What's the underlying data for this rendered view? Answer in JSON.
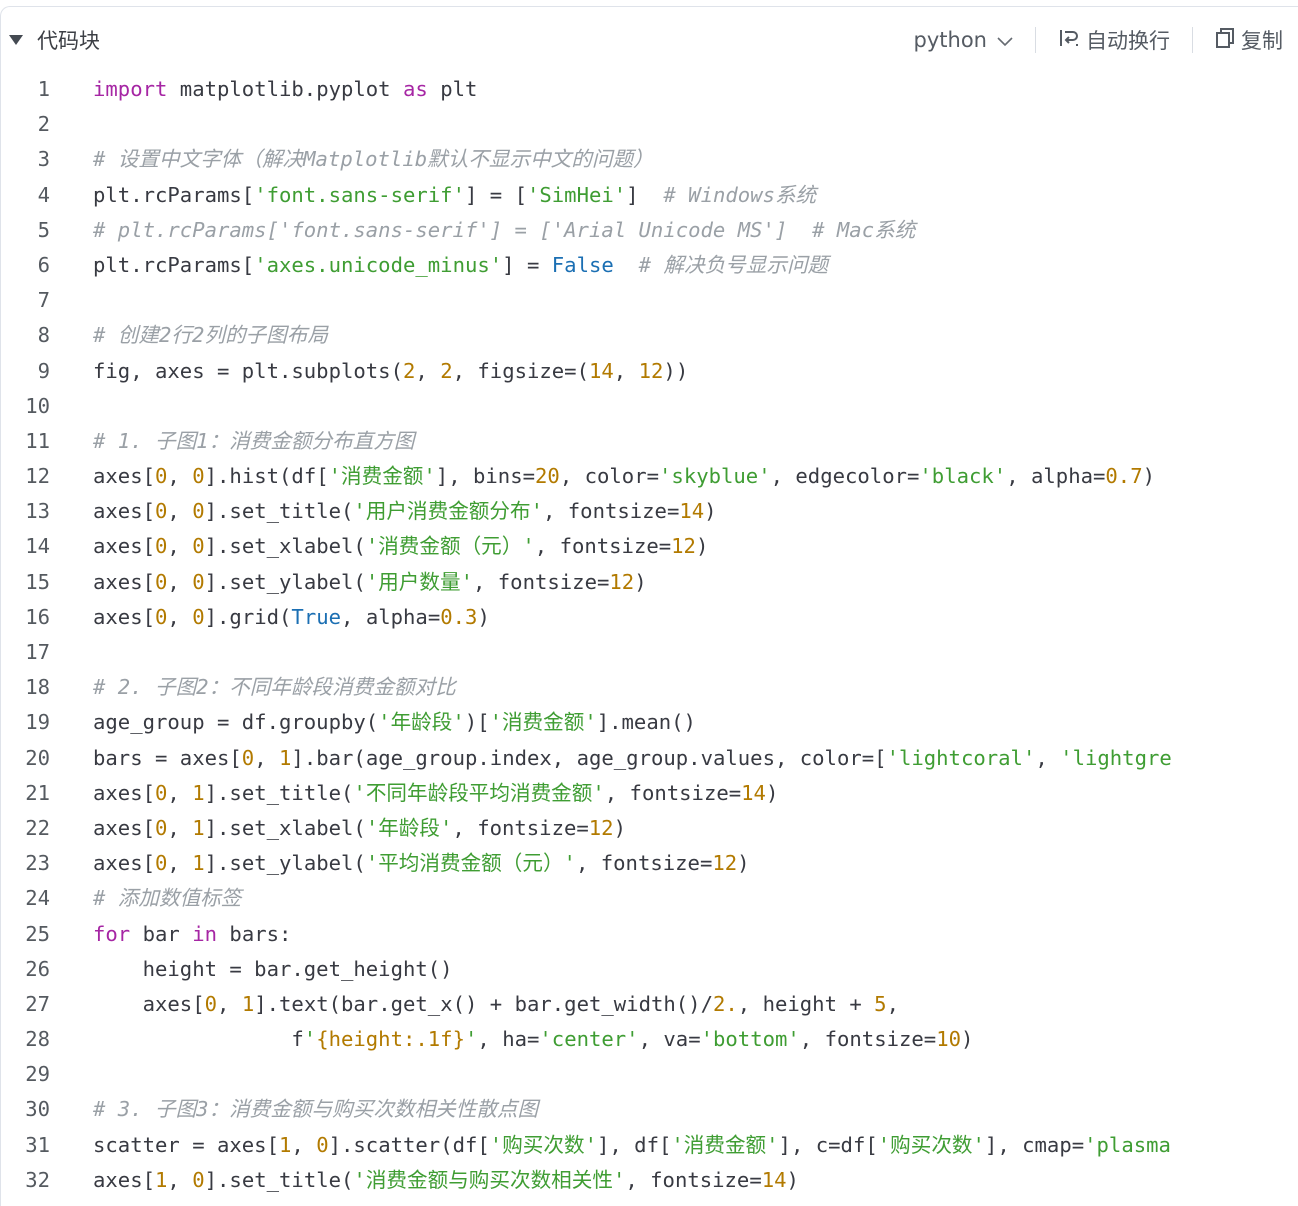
{
  "header": {
    "block_label": "代码块",
    "language": "python",
    "wrap_label": "自动换行",
    "copy_label": "复制"
  },
  "lines": [
    {
      "no": "1",
      "tokens": [
        [
          "k",
          "import"
        ],
        [
          "p",
          " matplotlib.pyplot "
        ],
        [
          "k",
          "as"
        ],
        [
          "p",
          " plt"
        ]
      ]
    },
    {
      "no": "2",
      "tokens": []
    },
    {
      "no": "3",
      "tokens": [
        [
          "c",
          "# 设置中文字体（解决Matplotlib默认不显示中文的问题）"
        ]
      ]
    },
    {
      "no": "4",
      "tokens": [
        [
          "p",
          "plt.rcParams["
        ],
        [
          "s",
          "'font.sans-serif'"
        ],
        [
          "p",
          "] = ["
        ],
        [
          "s",
          "'SimHei'"
        ],
        [
          "p",
          "]  "
        ],
        [
          "c",
          "# Windows系统"
        ]
      ]
    },
    {
      "no": "5",
      "tokens": [
        [
          "c",
          "# plt.rcParams['font.sans-serif'] = ['Arial Unicode MS']  # Mac系统"
        ]
      ]
    },
    {
      "no": "6",
      "tokens": [
        [
          "p",
          "plt.rcParams["
        ],
        [
          "s",
          "'axes.unicode_minus'"
        ],
        [
          "p",
          "] = "
        ],
        [
          "b",
          "False"
        ],
        [
          "p",
          "  "
        ],
        [
          "c",
          "# 解决负号显示问题"
        ]
      ]
    },
    {
      "no": "7",
      "tokens": []
    },
    {
      "no": "8",
      "tokens": [
        [
          "c",
          "# 创建2行2列的子图布局"
        ]
      ]
    },
    {
      "no": "9",
      "tokens": [
        [
          "p",
          "fig, axes = plt.subplots("
        ],
        [
          "n",
          "2"
        ],
        [
          "p",
          ", "
        ],
        [
          "n",
          "2"
        ],
        [
          "p",
          ", figsize=("
        ],
        [
          "n",
          "14"
        ],
        [
          "p",
          ", "
        ],
        [
          "n",
          "12"
        ],
        [
          "p",
          "))"
        ]
      ]
    },
    {
      "no": "10",
      "tokens": []
    },
    {
      "no": "11",
      "tokens": [
        [
          "c",
          "# 1. 子图1：消费金额分布直方图"
        ]
      ]
    },
    {
      "no": "12",
      "tokens": [
        [
          "p",
          "axes["
        ],
        [
          "n",
          "0"
        ],
        [
          "p",
          ", "
        ],
        [
          "n",
          "0"
        ],
        [
          "p",
          "].hist(df["
        ],
        [
          "s",
          "'消费金额'"
        ],
        [
          "p",
          "], bins="
        ],
        [
          "n",
          "20"
        ],
        [
          "p",
          ", color="
        ],
        [
          "s",
          "'skyblue'"
        ],
        [
          "p",
          ", edgecolor="
        ],
        [
          "s",
          "'black'"
        ],
        [
          "p",
          ", alpha="
        ],
        [
          "n",
          "0.7"
        ],
        [
          "p",
          ")"
        ]
      ]
    },
    {
      "no": "13",
      "tokens": [
        [
          "p",
          "axes["
        ],
        [
          "n",
          "0"
        ],
        [
          "p",
          ", "
        ],
        [
          "n",
          "0"
        ],
        [
          "p",
          "].set_title("
        ],
        [
          "s",
          "'用户消费金额分布'"
        ],
        [
          "p",
          ", fontsize="
        ],
        [
          "n",
          "14"
        ],
        [
          "p",
          ")"
        ]
      ]
    },
    {
      "no": "14",
      "tokens": [
        [
          "p",
          "axes["
        ],
        [
          "n",
          "0"
        ],
        [
          "p",
          ", "
        ],
        [
          "n",
          "0"
        ],
        [
          "p",
          "].set_xlabel("
        ],
        [
          "s",
          "'消费金额（元）'"
        ],
        [
          "p",
          ", fontsize="
        ],
        [
          "n",
          "12"
        ],
        [
          "p",
          ")"
        ]
      ]
    },
    {
      "no": "15",
      "tokens": [
        [
          "p",
          "axes["
        ],
        [
          "n",
          "0"
        ],
        [
          "p",
          ", "
        ],
        [
          "n",
          "0"
        ],
        [
          "p",
          "].set_ylabel("
        ],
        [
          "s",
          "'用户数量'"
        ],
        [
          "p",
          ", fontsize="
        ],
        [
          "n",
          "12"
        ],
        [
          "p",
          ")"
        ]
      ]
    },
    {
      "no": "16",
      "tokens": [
        [
          "p",
          "axes["
        ],
        [
          "n",
          "0"
        ],
        [
          "p",
          ", "
        ],
        [
          "n",
          "0"
        ],
        [
          "p",
          "].grid("
        ],
        [
          "b",
          "True"
        ],
        [
          "p",
          ", alpha="
        ],
        [
          "n",
          "0.3"
        ],
        [
          "p",
          ")"
        ]
      ]
    },
    {
      "no": "17",
      "tokens": []
    },
    {
      "no": "18",
      "tokens": [
        [
          "c",
          "# 2. 子图2：不同年龄段消费金额对比"
        ]
      ]
    },
    {
      "no": "19",
      "tokens": [
        [
          "p",
          "age_group = df.groupby("
        ],
        [
          "s",
          "'年龄段'"
        ],
        [
          "p",
          ")["
        ],
        [
          "s",
          "'消费金额'"
        ],
        [
          "p",
          "].mean()"
        ]
      ]
    },
    {
      "no": "20",
      "tokens": [
        [
          "p",
          "bars = axes["
        ],
        [
          "n",
          "0"
        ],
        [
          "p",
          ", "
        ],
        [
          "n",
          "1"
        ],
        [
          "p",
          "].bar(age_group.index, age_group.values, color=["
        ],
        [
          "s",
          "'lightcoral'"
        ],
        [
          "p",
          ", "
        ],
        [
          "s",
          "'lightgre"
        ]
      ]
    },
    {
      "no": "21",
      "tokens": [
        [
          "p",
          "axes["
        ],
        [
          "n",
          "0"
        ],
        [
          "p",
          ", "
        ],
        [
          "n",
          "1"
        ],
        [
          "p",
          "].set_title("
        ],
        [
          "s",
          "'不同年龄段平均消费金额'"
        ],
        [
          "p",
          ", fontsize="
        ],
        [
          "n",
          "14"
        ],
        [
          "p",
          ")"
        ]
      ]
    },
    {
      "no": "22",
      "tokens": [
        [
          "p",
          "axes["
        ],
        [
          "n",
          "0"
        ],
        [
          "p",
          ", "
        ],
        [
          "n",
          "1"
        ],
        [
          "p",
          "].set_xlabel("
        ],
        [
          "s",
          "'年龄段'"
        ],
        [
          "p",
          ", fontsize="
        ],
        [
          "n",
          "12"
        ],
        [
          "p",
          ")"
        ]
      ]
    },
    {
      "no": "23",
      "tokens": [
        [
          "p",
          "axes["
        ],
        [
          "n",
          "0"
        ],
        [
          "p",
          ", "
        ],
        [
          "n",
          "1"
        ],
        [
          "p",
          "].set_ylabel("
        ],
        [
          "s",
          "'平均消费金额（元）'"
        ],
        [
          "p",
          ", fontsize="
        ],
        [
          "n",
          "12"
        ],
        [
          "p",
          ")"
        ]
      ]
    },
    {
      "no": "24",
      "tokens": [
        [
          "c",
          "# 添加数值标签"
        ]
      ]
    },
    {
      "no": "25",
      "tokens": [
        [
          "k",
          "for"
        ],
        [
          "p",
          " bar "
        ],
        [
          "k",
          "in"
        ],
        [
          "p",
          " bars:"
        ]
      ]
    },
    {
      "no": "26",
      "tokens": [
        [
          "p",
          "    height = bar.get_height()"
        ]
      ]
    },
    {
      "no": "27",
      "tokens": [
        [
          "p",
          "    axes["
        ],
        [
          "n",
          "0"
        ],
        [
          "p",
          ", "
        ],
        [
          "n",
          "1"
        ],
        [
          "p",
          "].text(bar.get_x() + bar.get_width()/"
        ],
        [
          "n",
          "2."
        ],
        [
          "p",
          ", height + "
        ],
        [
          "n",
          "5"
        ],
        [
          "p",
          ","
        ]
      ]
    },
    {
      "no": "28",
      "tokens": [
        [
          "p",
          "                f"
        ],
        [
          "s",
          "'"
        ],
        [
          "n",
          "{height:.1f}"
        ],
        [
          "s",
          "'"
        ],
        [
          "p",
          ", ha="
        ],
        [
          "s",
          "'center'"
        ],
        [
          "p",
          ", va="
        ],
        [
          "s",
          "'bottom'"
        ],
        [
          "p",
          ", fontsize="
        ],
        [
          "n",
          "10"
        ],
        [
          "p",
          ")"
        ]
      ]
    },
    {
      "no": "29",
      "tokens": []
    },
    {
      "no": "30",
      "tokens": [
        [
          "c",
          "# 3. 子图3：消费金额与购买次数相关性散点图"
        ]
      ]
    },
    {
      "no": "31",
      "tokens": [
        [
          "p",
          "scatter = axes["
        ],
        [
          "n",
          "1"
        ],
        [
          "p",
          ", "
        ],
        [
          "n",
          "0"
        ],
        [
          "p",
          "].scatter(df["
        ],
        [
          "s",
          "'购买次数'"
        ],
        [
          "p",
          "], df["
        ],
        [
          "s",
          "'消费金额'"
        ],
        [
          "p",
          "], c=df["
        ],
        [
          "s",
          "'购买次数'"
        ],
        [
          "p",
          "], cmap="
        ],
        [
          "s",
          "'plasma"
        ]
      ]
    },
    {
      "no": "32",
      "tokens": [
        [
          "p",
          "axes["
        ],
        [
          "n",
          "1"
        ],
        [
          "p",
          ", "
        ],
        [
          "n",
          "0"
        ],
        [
          "p",
          "].set_title("
        ],
        [
          "s",
          "'消费金额与购买次数相关性'"
        ],
        [
          "p",
          ", fontsize="
        ],
        [
          "n",
          "14"
        ],
        [
          "p",
          ")"
        ]
      ]
    }
  ]
}
